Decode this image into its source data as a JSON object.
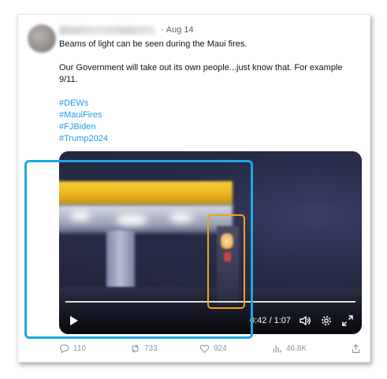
{
  "post": {
    "author_name": "",
    "separator": "·",
    "date": "Aug 14",
    "line1": "Beams of light can be seen during the Maui fires.",
    "line2": "Our Government will take out its own people...just know that. For example 9/11.",
    "hashtags": [
      "#DEWs",
      "#MauiFires",
      "#FJBiden",
      "#Trump2024"
    ]
  },
  "video": {
    "time": "0:42 / 1:07",
    "progress": 0.63,
    "controls": [
      "play-icon",
      "volume-icon",
      "settings-icon",
      "fullscreen-icon"
    ]
  },
  "actions": {
    "replies": "110",
    "retweets": "733",
    "likes": "924",
    "views": "46.8K"
  },
  "colors": {
    "hashtag": "#1d9bf0",
    "highlight_blue": "#1ea7e4",
    "highlight_orange": "#f2a21a"
  }
}
